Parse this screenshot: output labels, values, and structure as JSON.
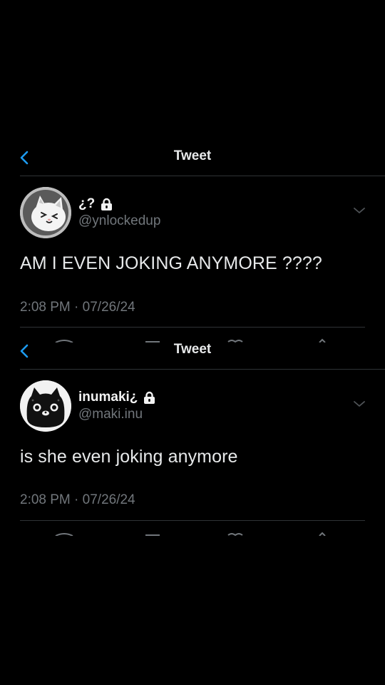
{
  "tweets": [
    {
      "header_title": "Tweet",
      "display_name": "¿?",
      "handle": "@ynlockedup",
      "text": "AM I EVEN JOKING ANYMORE ????",
      "time": "2:08 PM",
      "separator": "·",
      "date": "07/26/24",
      "avatar_icon": "white-cat-avatar",
      "locked": true
    },
    {
      "header_title": "Tweet",
      "display_name": "inumaki¿",
      "handle": "@maki.inu",
      "text": "is she even joking anymore",
      "time": "2:08 PM",
      "separator": "·",
      "date": "07/26/24",
      "avatar_icon": "black-cat-avatar",
      "locked": true
    }
  ],
  "colors": {
    "background": "#000000",
    "accent": "#1d9bf0",
    "text_primary": "#e7e9ea",
    "text_secondary": "#71767b",
    "divider": "#2f3336"
  }
}
